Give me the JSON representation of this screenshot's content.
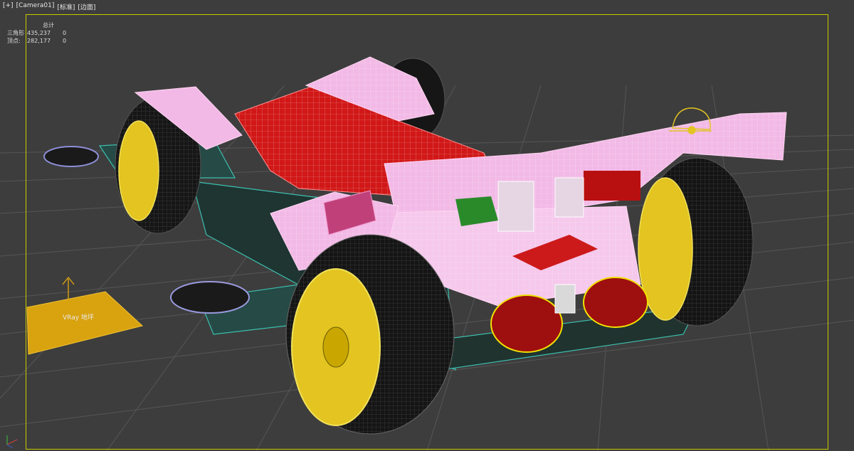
{
  "viewport": {
    "menu": [
      "[+]",
      "[Camera01]",
      "[标准]",
      "[边面]"
    ]
  },
  "stats": {
    "header": "总计",
    "rows": [
      {
        "label": "三角形",
        "total": "435,237",
        "selected": "0"
      },
      {
        "label": "顶点:",
        "total": "282,177",
        "selected": "0"
      }
    ]
  },
  "scene": {
    "plane_label": "VRay 地坪"
  },
  "colors": {
    "background": "#3d3d3d",
    "grid": "#555555",
    "frame": "#c9c900",
    "body_pink": "#f2b9e6",
    "body_red": "#d11717",
    "rim_yellow": "#e3c420",
    "chassis_teal": "#3dbfae",
    "plane_orange": "#d9a20f"
  },
  "icons": [
    "axis-gizmo-icon",
    "helmet-icon"
  ]
}
